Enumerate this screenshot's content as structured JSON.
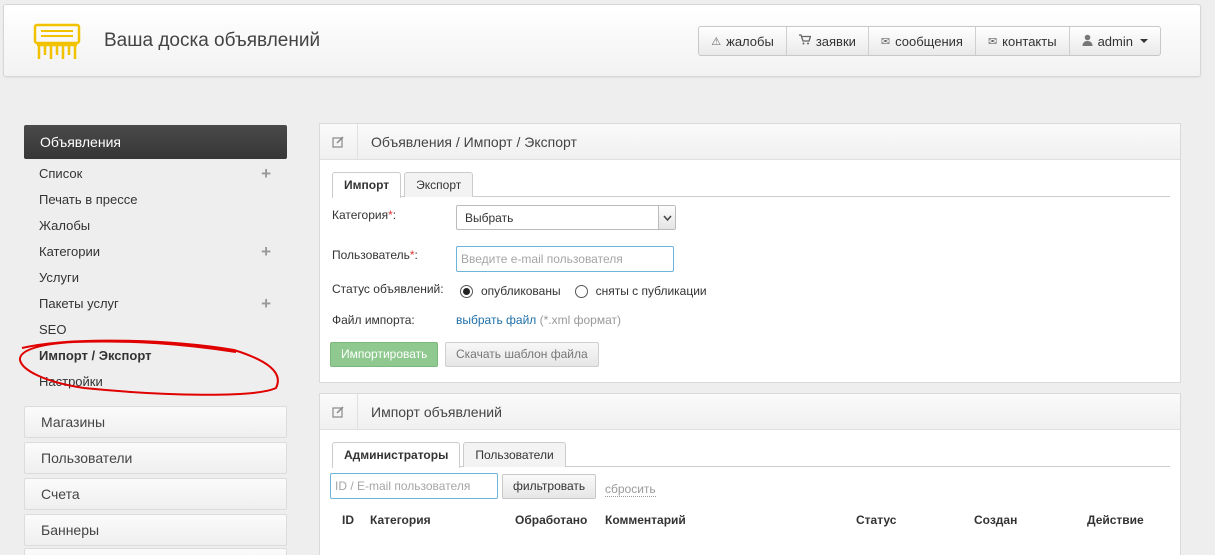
{
  "header": {
    "site_title": "Ваша доска объявлений",
    "nav": [
      {
        "icon": "warning-icon",
        "label": "жалобы"
      },
      {
        "icon": "cart-icon",
        "label": "заявки"
      },
      {
        "icon": "envelope-icon",
        "label": "сообщения"
      },
      {
        "icon": "envelope-icon",
        "label": "контакты"
      },
      {
        "icon": "user-icon",
        "label": "admin"
      }
    ]
  },
  "sidebar": {
    "active_section": "Объявления",
    "items": [
      {
        "label": "Список",
        "has_plus": true
      },
      {
        "label": "Печать в прессе",
        "has_plus": false
      },
      {
        "label": "Жалобы",
        "has_plus": false
      },
      {
        "label": "Категории",
        "has_plus": true
      },
      {
        "label": "Услуги",
        "has_plus": false
      },
      {
        "label": "Пакеты услуг",
        "has_plus": true
      },
      {
        "label": "SEO",
        "has_plus": false
      },
      {
        "label": "Импорт / Экспорт",
        "has_plus": false,
        "current": true
      },
      {
        "label": "Настройки",
        "has_plus": false
      }
    ],
    "groups": [
      "Магазины",
      "Пользователи",
      "Счета",
      "Баннеры"
    ]
  },
  "import_panel": {
    "title": "Объявления / Импорт / Экспорт",
    "tabs": [
      "Импорт",
      "Экспорт"
    ],
    "category_label": "Категория",
    "category_value": "Выбрать",
    "user_label": "Пользователь",
    "user_placeholder": "Введите e-mail пользователя",
    "status_label": "Статус объявлений:",
    "status_options": [
      {
        "label": "опубликованы",
        "checked": true
      },
      {
        "label": "сняты с публикации",
        "checked": false
      }
    ],
    "file_label": "Файл импорта:",
    "file_link": "выбрать файл",
    "file_hint": "(*.xml формат)",
    "import_button": "Импортировать",
    "template_button": "Скачать шаблон файла"
  },
  "list_panel": {
    "title": "Импорт объявлений",
    "tabs": [
      "Администраторы",
      "Пользователи"
    ],
    "filter_placeholder": "ID / E-mail пользователя",
    "filter_button": "фильтровать",
    "reset_link": "сбросить",
    "columns": [
      "ID",
      "Категория",
      "Обработано",
      "Комментарий",
      "Статус",
      "Создан",
      "Действие"
    ]
  },
  "colors": {
    "accent_green": "#8fc98f",
    "link_blue": "#1f6fa8",
    "logo_yellow": "#f2c200",
    "annotation_red": "#e00000"
  }
}
